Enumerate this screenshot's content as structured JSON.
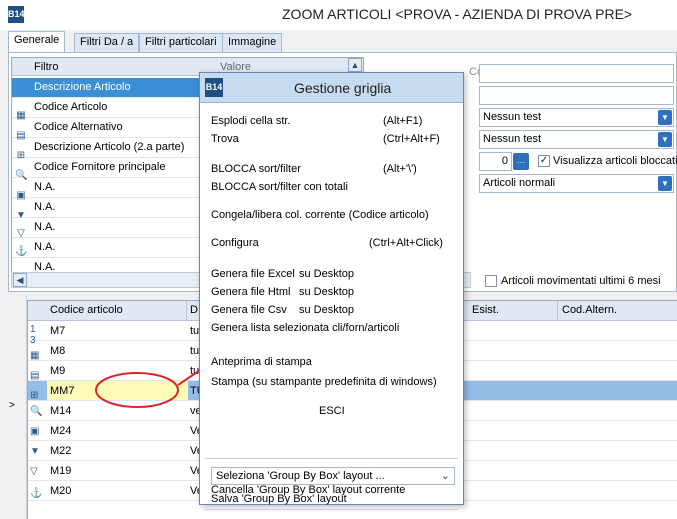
{
  "window": {
    "title": "ZOOM ARTICOLI <PROVA - AZIENDA DI PROVA PRE>",
    "logo": "B14"
  },
  "tabs": [
    {
      "label": "Generale"
    },
    {
      "label": "Filtri Da / a"
    },
    {
      "label": "Filtri particolari"
    },
    {
      "label": "Immagine"
    }
  ],
  "filter_grid": {
    "col_filter": "Filtro",
    "col_value": "Valore",
    "rows": [
      "Descrizione Articolo",
      "Codice Articolo",
      "Codice Alternativo",
      "Descrizione Articolo (2.a parte)",
      "Codice Fornitore principale",
      "N.A.",
      "N.A.",
      "N.A.",
      "N.A.",
      "N.A."
    ]
  },
  "right_panel": {
    "label_partial": "Codice ar",
    "test1": "Nessun test",
    "test2": "Nessun test",
    "spin_value": "0",
    "show_blocked_label": "Visualizza articoli bloccati",
    "show_blocked_checked": true,
    "articles_type": "Articoli normali",
    "moved_label": "Articoli movimentati ultimi 6 mesi",
    "moved_checked": false
  },
  "main_grid": {
    "headers": {
      "code": "Codice articolo",
      "desc": "D",
      "esist": "Esist.",
      "alt": "Cod.Altern."
    },
    "rows": [
      {
        "code": "M7",
        "desc": "tu"
      },
      {
        "code": "M8",
        "desc": "tu"
      },
      {
        "code": "M9",
        "desc": "tu"
      },
      {
        "code": "MM7",
        "desc": "TU"
      },
      {
        "code": "M14",
        "desc": "ve"
      },
      {
        "code": "M24",
        "desc": "Ve"
      },
      {
        "code": "M22",
        "desc": "Ve"
      },
      {
        "code": "M19",
        "desc": "Ve"
      },
      {
        "code": "M20",
        "desc": "Ve"
      }
    ],
    "row_marker": ">"
  },
  "dialog": {
    "title": "Gestione griglia",
    "logo": "B14",
    "items": {
      "expand": "Esplodi cella str.",
      "expand_key": "(Alt+F1)",
      "find": "Trova",
      "find_key": "(Ctrl+Alt+F)",
      "lock": "BLOCCA sort/filter",
      "lock_key": "(Alt+'\\')",
      "lock_totals": "BLOCCA sort/filter con totali",
      "freeze": "Congela/libera col. corrente (Codice articolo)",
      "configure": "Configura",
      "configure_key": "(Ctrl+Alt+Click)",
      "gen_excel": "Genera file Excel",
      "gen_html": "Genera file Html",
      "gen_csv": "Genera file Csv",
      "desktop": "su Desktop",
      "gen_list": "Genera lista selezionata cli/forn/articoli",
      "preview": "Anteprima di stampa",
      "print": "Stampa (su stampante predefinita di windows)",
      "exit": "ESCI",
      "group_select": "Seleziona 'Group By Box' layout ...",
      "group_save": "Salva 'Group By Box' layout",
      "group_delete": "Cancella 'Group By Box' layout corrente"
    }
  },
  "colors": {
    "selection": "#3b8fd6",
    "annotation": "#d9232a",
    "highlight_cell": "#fffbb8"
  }
}
